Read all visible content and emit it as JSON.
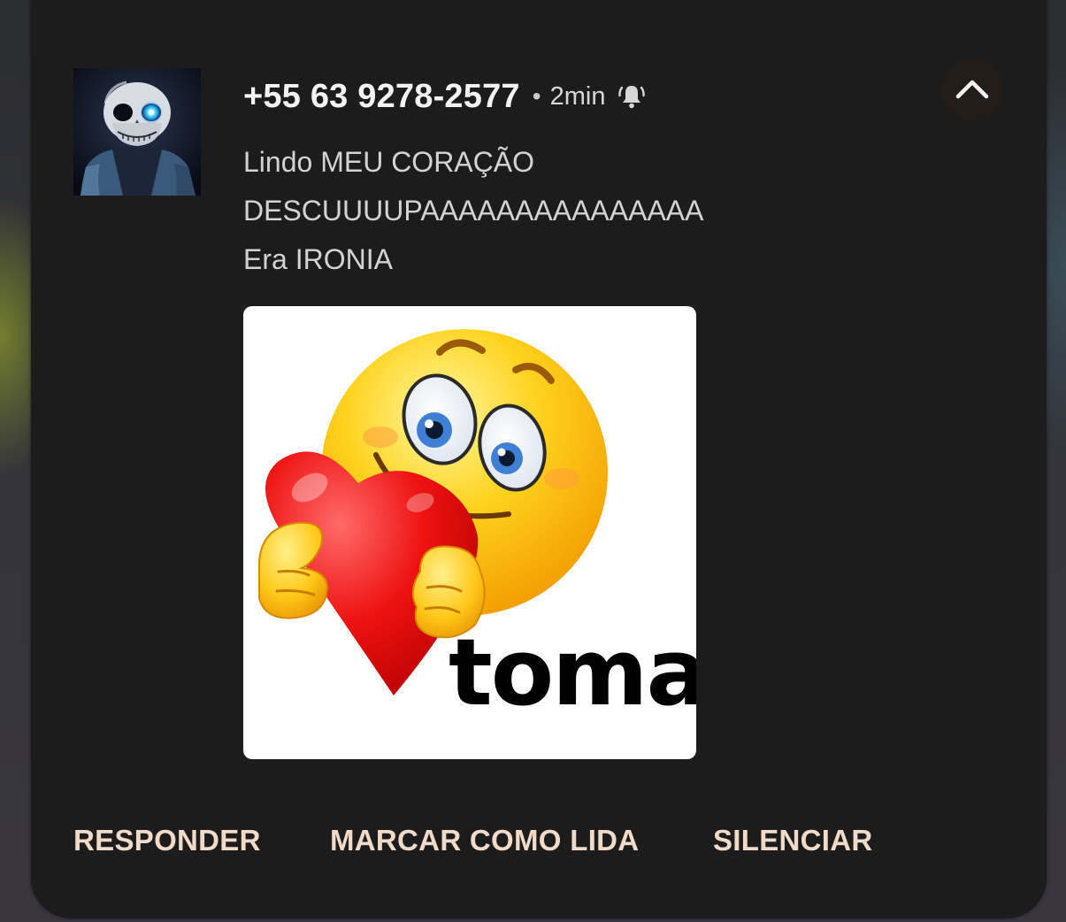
{
  "notification": {
    "sender": "+55 63 9278-2577",
    "separator": "•",
    "time": "2min",
    "message_lines": [
      "Lindo MEU CORAÇÃO",
      "DESCUUUUPAAAAAAAAAAAAAAA",
      "Era IRONIA"
    ],
    "sticker": {
      "caption": "toma"
    },
    "icons": {
      "avatar": "skull-avatar",
      "alert": "bell-ringing-icon",
      "collapse": "chevron-up-icon"
    },
    "actions": {
      "reply": "RESPONDER",
      "mark_read": "MARCAR COMO LIDA",
      "mute": "SILENCIAR"
    }
  },
  "colors": {
    "card_background": "#1c1c1c",
    "sender_text": "#f3f3f3",
    "message_text": "#d3d3d3",
    "action_text": "#f2dac8",
    "collapse_button": "#231d1a"
  }
}
